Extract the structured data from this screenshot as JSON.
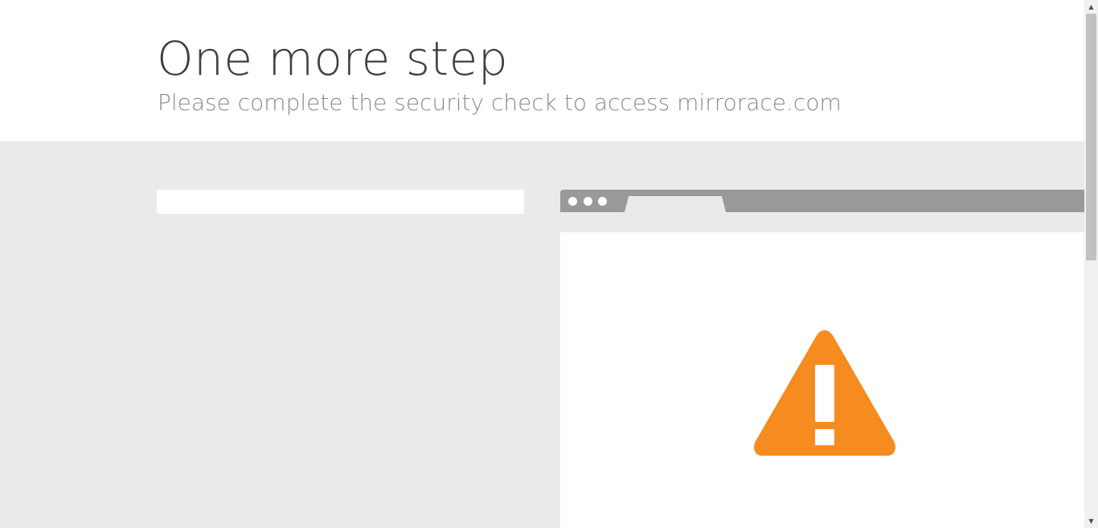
{
  "header": {
    "title": "One more step",
    "subtitle": "Please complete the security check to access mirrorace.com"
  },
  "colors": {
    "warning": "#f68b1f",
    "header_background": "#ffffff",
    "page_background": "#eaeaea",
    "browser_frame": "#999999"
  },
  "icons": {
    "warning": "warning-icon",
    "scroll_up": "chevron-up-icon",
    "scroll_down": "chevron-down-icon"
  },
  "scrollbar": {
    "up_glyph": "▲",
    "down_glyph": "▼"
  }
}
